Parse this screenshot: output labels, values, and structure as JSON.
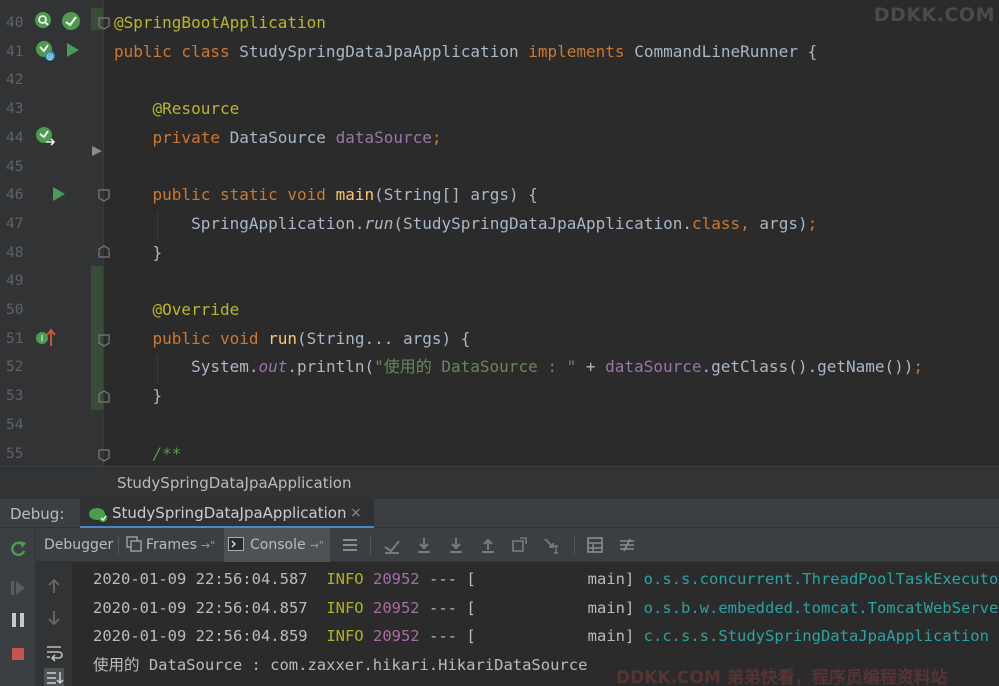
{
  "editor": {
    "watermark": "DDKK.COM",
    "lines": [
      {
        "num": "40",
        "tokens": [
          {
            "t": "@SpringBootApplication",
            "c": "ann"
          }
        ]
      },
      {
        "num": "41",
        "tokens": [
          {
            "t": "public class ",
            "c": "kw"
          },
          {
            "t": "StudySpringDataJpaApplication ",
            "c": ""
          },
          {
            "t": "implements ",
            "c": "kw"
          },
          {
            "t": "CommandLineRunner {",
            "c": ""
          }
        ]
      },
      {
        "num": "42",
        "tokens": []
      },
      {
        "num": "43",
        "tokens": [
          {
            "t": "    ",
            "c": ""
          },
          {
            "t": "@Resource",
            "c": "ann"
          }
        ]
      },
      {
        "num": "44",
        "tokens": [
          {
            "t": "    ",
            "c": ""
          },
          {
            "t": "private ",
            "c": "kw"
          },
          {
            "t": "DataSource ",
            "c": ""
          },
          {
            "t": "dataSource",
            "c": "fld"
          },
          {
            "t": ";",
            "c": "kw"
          }
        ]
      },
      {
        "num": "45",
        "tokens": []
      },
      {
        "num": "46",
        "tokens": [
          {
            "t": "    ",
            "c": ""
          },
          {
            "t": "public static void ",
            "c": "kw"
          },
          {
            "t": "main",
            "c": "fn"
          },
          {
            "t": "(String[] args) {",
            "c": ""
          }
        ]
      },
      {
        "num": "47",
        "tokens": [
          {
            "t": "        SpringApplication.",
            "c": ""
          },
          {
            "t": "run",
            "c": "ital"
          },
          {
            "t": "(StudySpringDataJpaApplication.",
            "c": ""
          },
          {
            "t": "class",
            "c": "kw"
          },
          {
            "t": ", ",
            "c": "kw"
          },
          {
            "t": "args)",
            "c": ""
          },
          {
            "t": ";",
            "c": "kw"
          }
        ]
      },
      {
        "num": "48",
        "tokens": [
          {
            "t": "    }",
            "c": ""
          }
        ]
      },
      {
        "num": "49",
        "tokens": []
      },
      {
        "num": "50",
        "tokens": [
          {
            "t": "    ",
            "c": ""
          },
          {
            "t": "@Override",
            "c": "ann"
          }
        ]
      },
      {
        "num": "51",
        "tokens": [
          {
            "t": "    ",
            "c": ""
          },
          {
            "t": "public void ",
            "c": "kw"
          },
          {
            "t": "run",
            "c": "fn"
          },
          {
            "t": "(String... args) {",
            "c": ""
          }
        ]
      },
      {
        "num": "52",
        "tokens": [
          {
            "t": "        System.",
            "c": ""
          },
          {
            "t": "out",
            "c": "fld ital"
          },
          {
            "t": ".println(",
            "c": ""
          },
          {
            "t": "\"使用的 DataSource : \"",
            "c": "str"
          },
          {
            "t": " + ",
            "c": ""
          },
          {
            "t": "dataSource",
            "c": "fld"
          },
          {
            "t": ".getClass().getName())",
            "c": ""
          },
          {
            "t": ";",
            "c": "kw"
          }
        ]
      },
      {
        "num": "53",
        "tokens": [
          {
            "t": "    }",
            "c": ""
          }
        ]
      },
      {
        "num": "54",
        "tokens": []
      },
      {
        "num": "55",
        "tokens": [
          {
            "t": "    ",
            "c": ""
          },
          {
            "t": "/**",
            "c": "cmt"
          }
        ]
      }
    ]
  },
  "breadcrumb": "StudySpringDataJpaApplication",
  "debug": {
    "label": "Debug:",
    "tab_label": "StudySpringDataJpaApplication",
    "tab_close": "×"
  },
  "toolbar": {
    "debugger": "Debugger",
    "frames": "Frames",
    "console": "Console",
    "pin": "→\""
  },
  "console": {
    "lines": [
      {
        "ts": "2020-01-09 22:56:04.587",
        "level": "INFO",
        "pid": "20952",
        "sep": "--- [",
        "thread": "main]",
        "logger": "o.s.s.concurrent.ThreadPoolTaskExecutor"
      },
      {
        "ts": "2020-01-09 22:56:04.857",
        "level": "INFO",
        "pid": "20952",
        "sep": "--- [",
        "thread": "main]",
        "logger": "o.s.b.w.embedded.tomcat.TomcatWebServer"
      },
      {
        "ts": "2020-01-09 22:56:04.859",
        "level": "INFO",
        "pid": "20952",
        "sep": "--- [",
        "thread": "main]",
        "logger": "c.c.s.s.StudySpringDataJpaApplication"
      }
    ],
    "output": "使用的 DataSource : com.zaxxer.hikari.HikariDataSource",
    "watermark": "DDKK.COM 弟弟快看，程序员编程资料站"
  }
}
